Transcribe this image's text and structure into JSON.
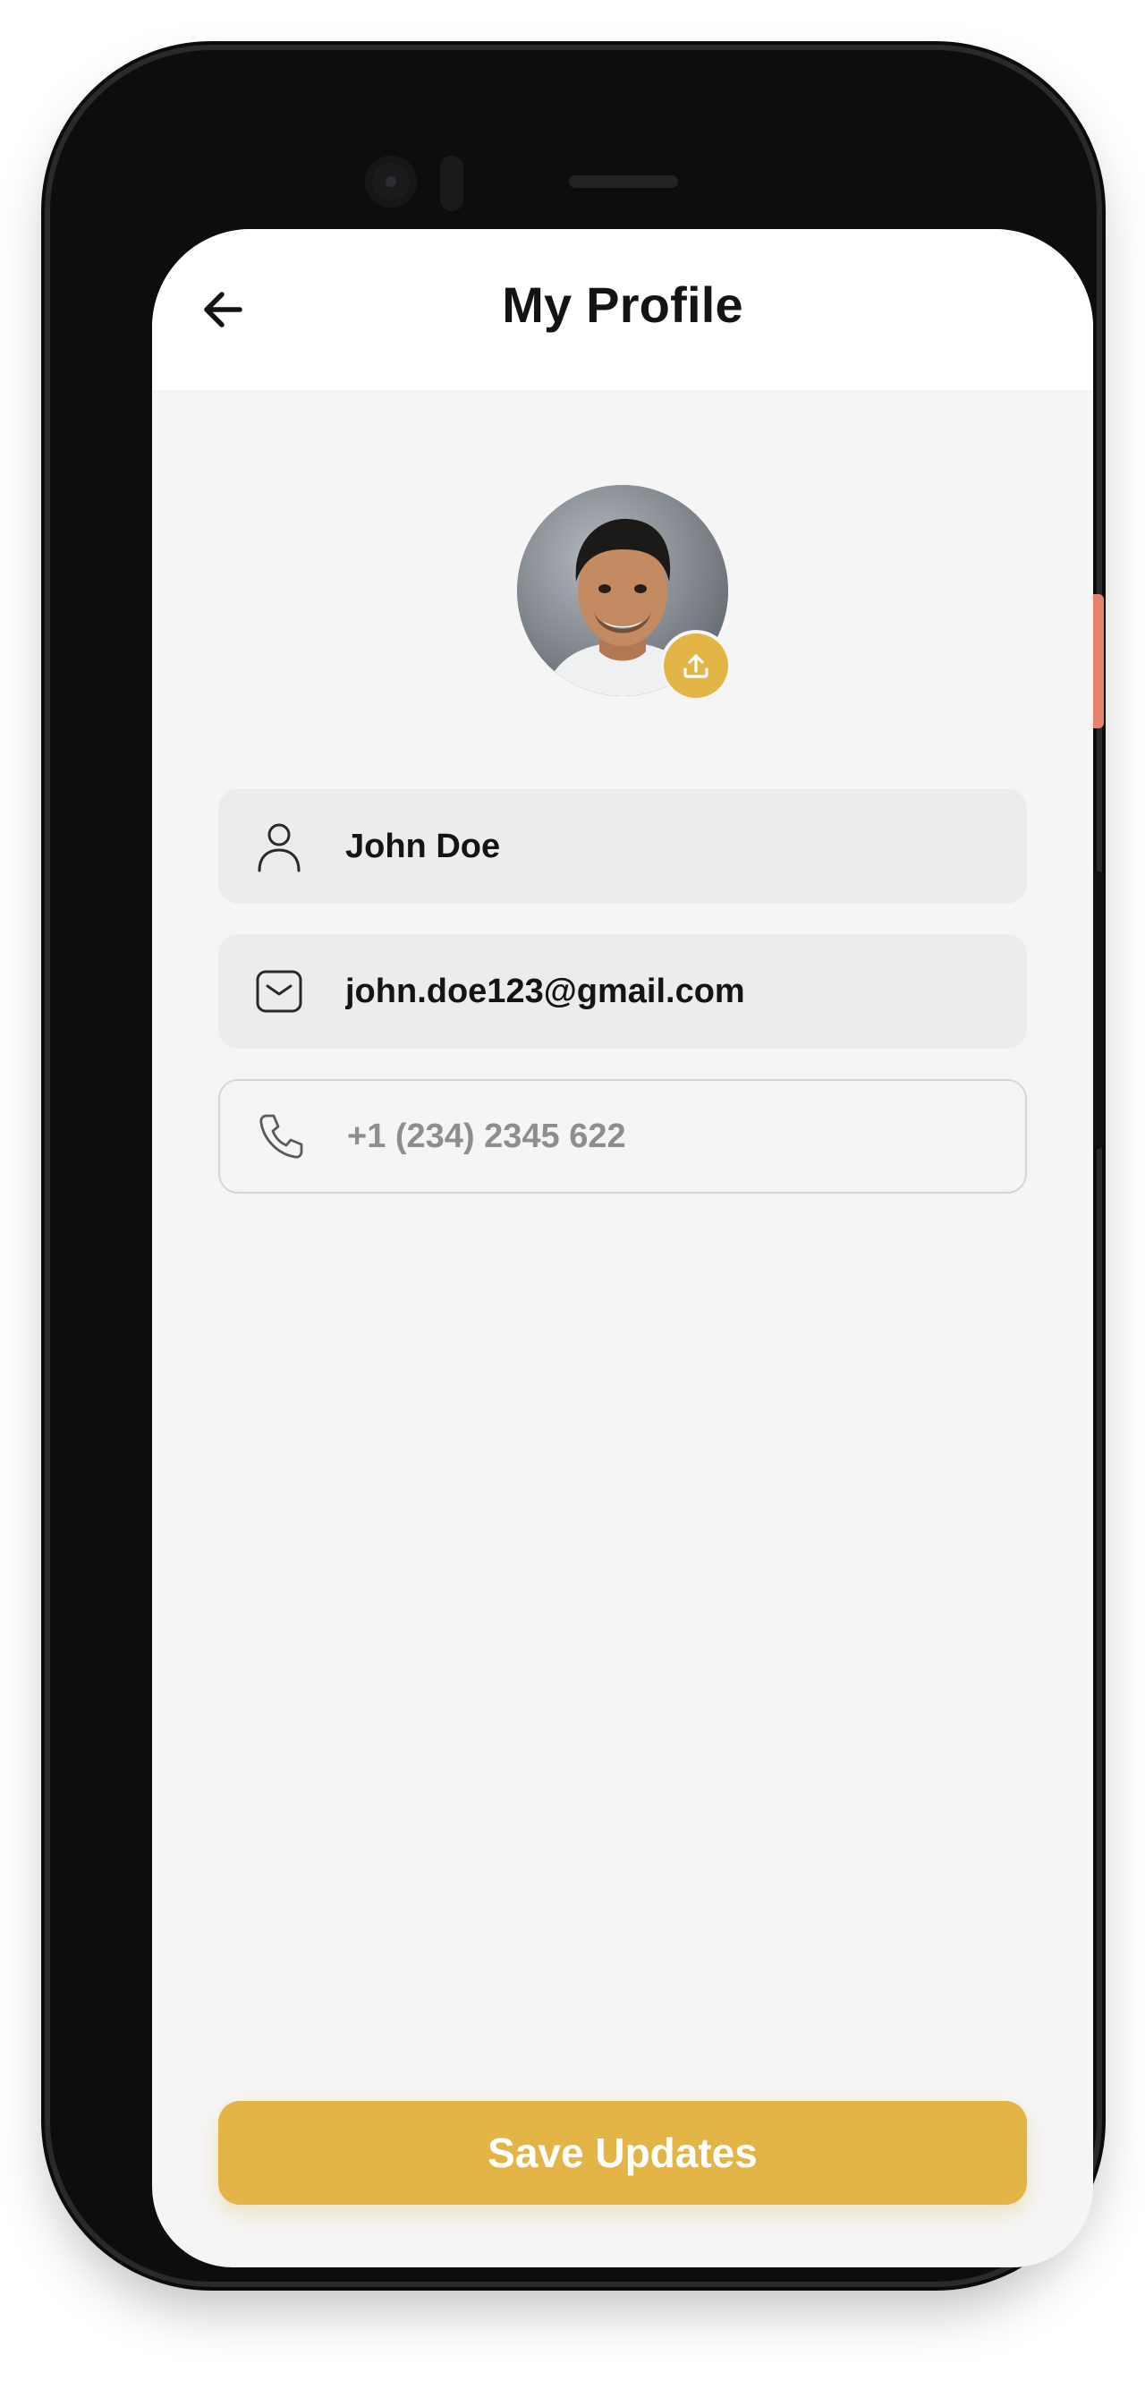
{
  "header": {
    "title": "My Profile",
    "back_icon": "arrow-left-icon"
  },
  "avatar": {
    "description_icon": "profile-photo",
    "upload_icon": "upload-icon"
  },
  "fields": {
    "name": {
      "icon": "user-icon",
      "value": "John Doe"
    },
    "email": {
      "icon": "mail-icon",
      "value": "john.doe123@gmail.com"
    },
    "phone": {
      "icon": "phone-icon",
      "placeholder": "+1 (234) 2345 622"
    }
  },
  "actions": {
    "save_label": "Save Updates"
  },
  "colors": {
    "accent": "#e3b446",
    "screen_background": "#f5f5f5",
    "field_filled": "#ececec",
    "field_border": "#d6d6d6",
    "text": "#141414",
    "placeholder": "#8e8e8e"
  }
}
